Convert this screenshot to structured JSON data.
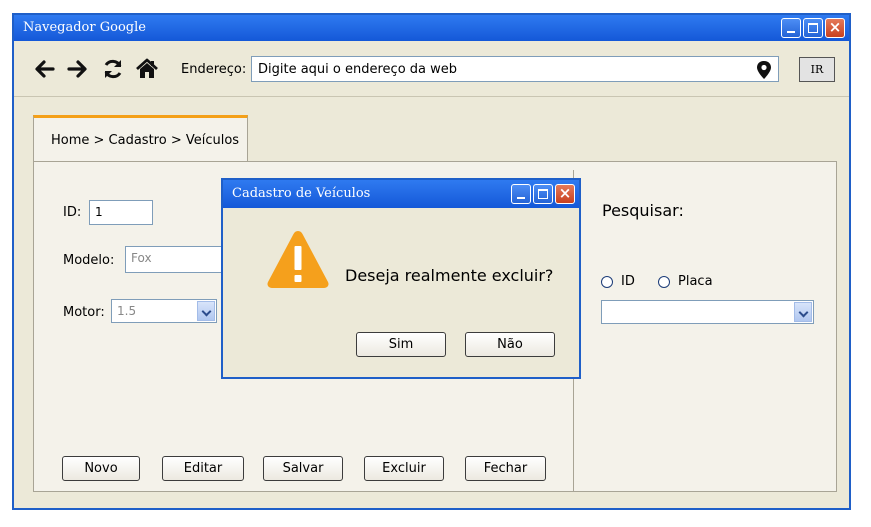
{
  "window": {
    "title": "Navegador Google",
    "controls": [
      "minimize",
      "maximize",
      "close"
    ]
  },
  "toolbar": {
    "icons": [
      "back-arrow-icon",
      "forward-arrow-icon",
      "refresh-icon",
      "home-icon"
    ],
    "address_label": "Endereço:",
    "address_placeholder": "Digite aqui o endereço da web",
    "go_label": "IR"
  },
  "breadcrumb": "Home > Cadastro > Veículos",
  "form": {
    "id_label": "ID:",
    "id_value": "1",
    "modelo_label": "Modelo:",
    "modelo_value": "Fox",
    "motor_label": "Motor:",
    "motor_value": "1.5"
  },
  "buttons": {
    "novo": "Novo",
    "editar": "Editar",
    "salvar": "Salvar",
    "excluir": "Excluir",
    "fechar": "Fechar"
  },
  "search": {
    "title": "Pesquisar:",
    "option_id": "ID",
    "option_placa": "Placa",
    "selected_option": "",
    "select_value": ""
  },
  "dialog": {
    "title": "Cadastro de Veículos",
    "message": "Deseja realmente excluir?",
    "yes_label": "Sim",
    "no_label": "Não",
    "icon": "warning-icon"
  },
  "colors": {
    "titlebar": "#1458d8",
    "background": "#ece9d8",
    "tab_accent": "#f4a018",
    "warning": "#f5a01c"
  }
}
